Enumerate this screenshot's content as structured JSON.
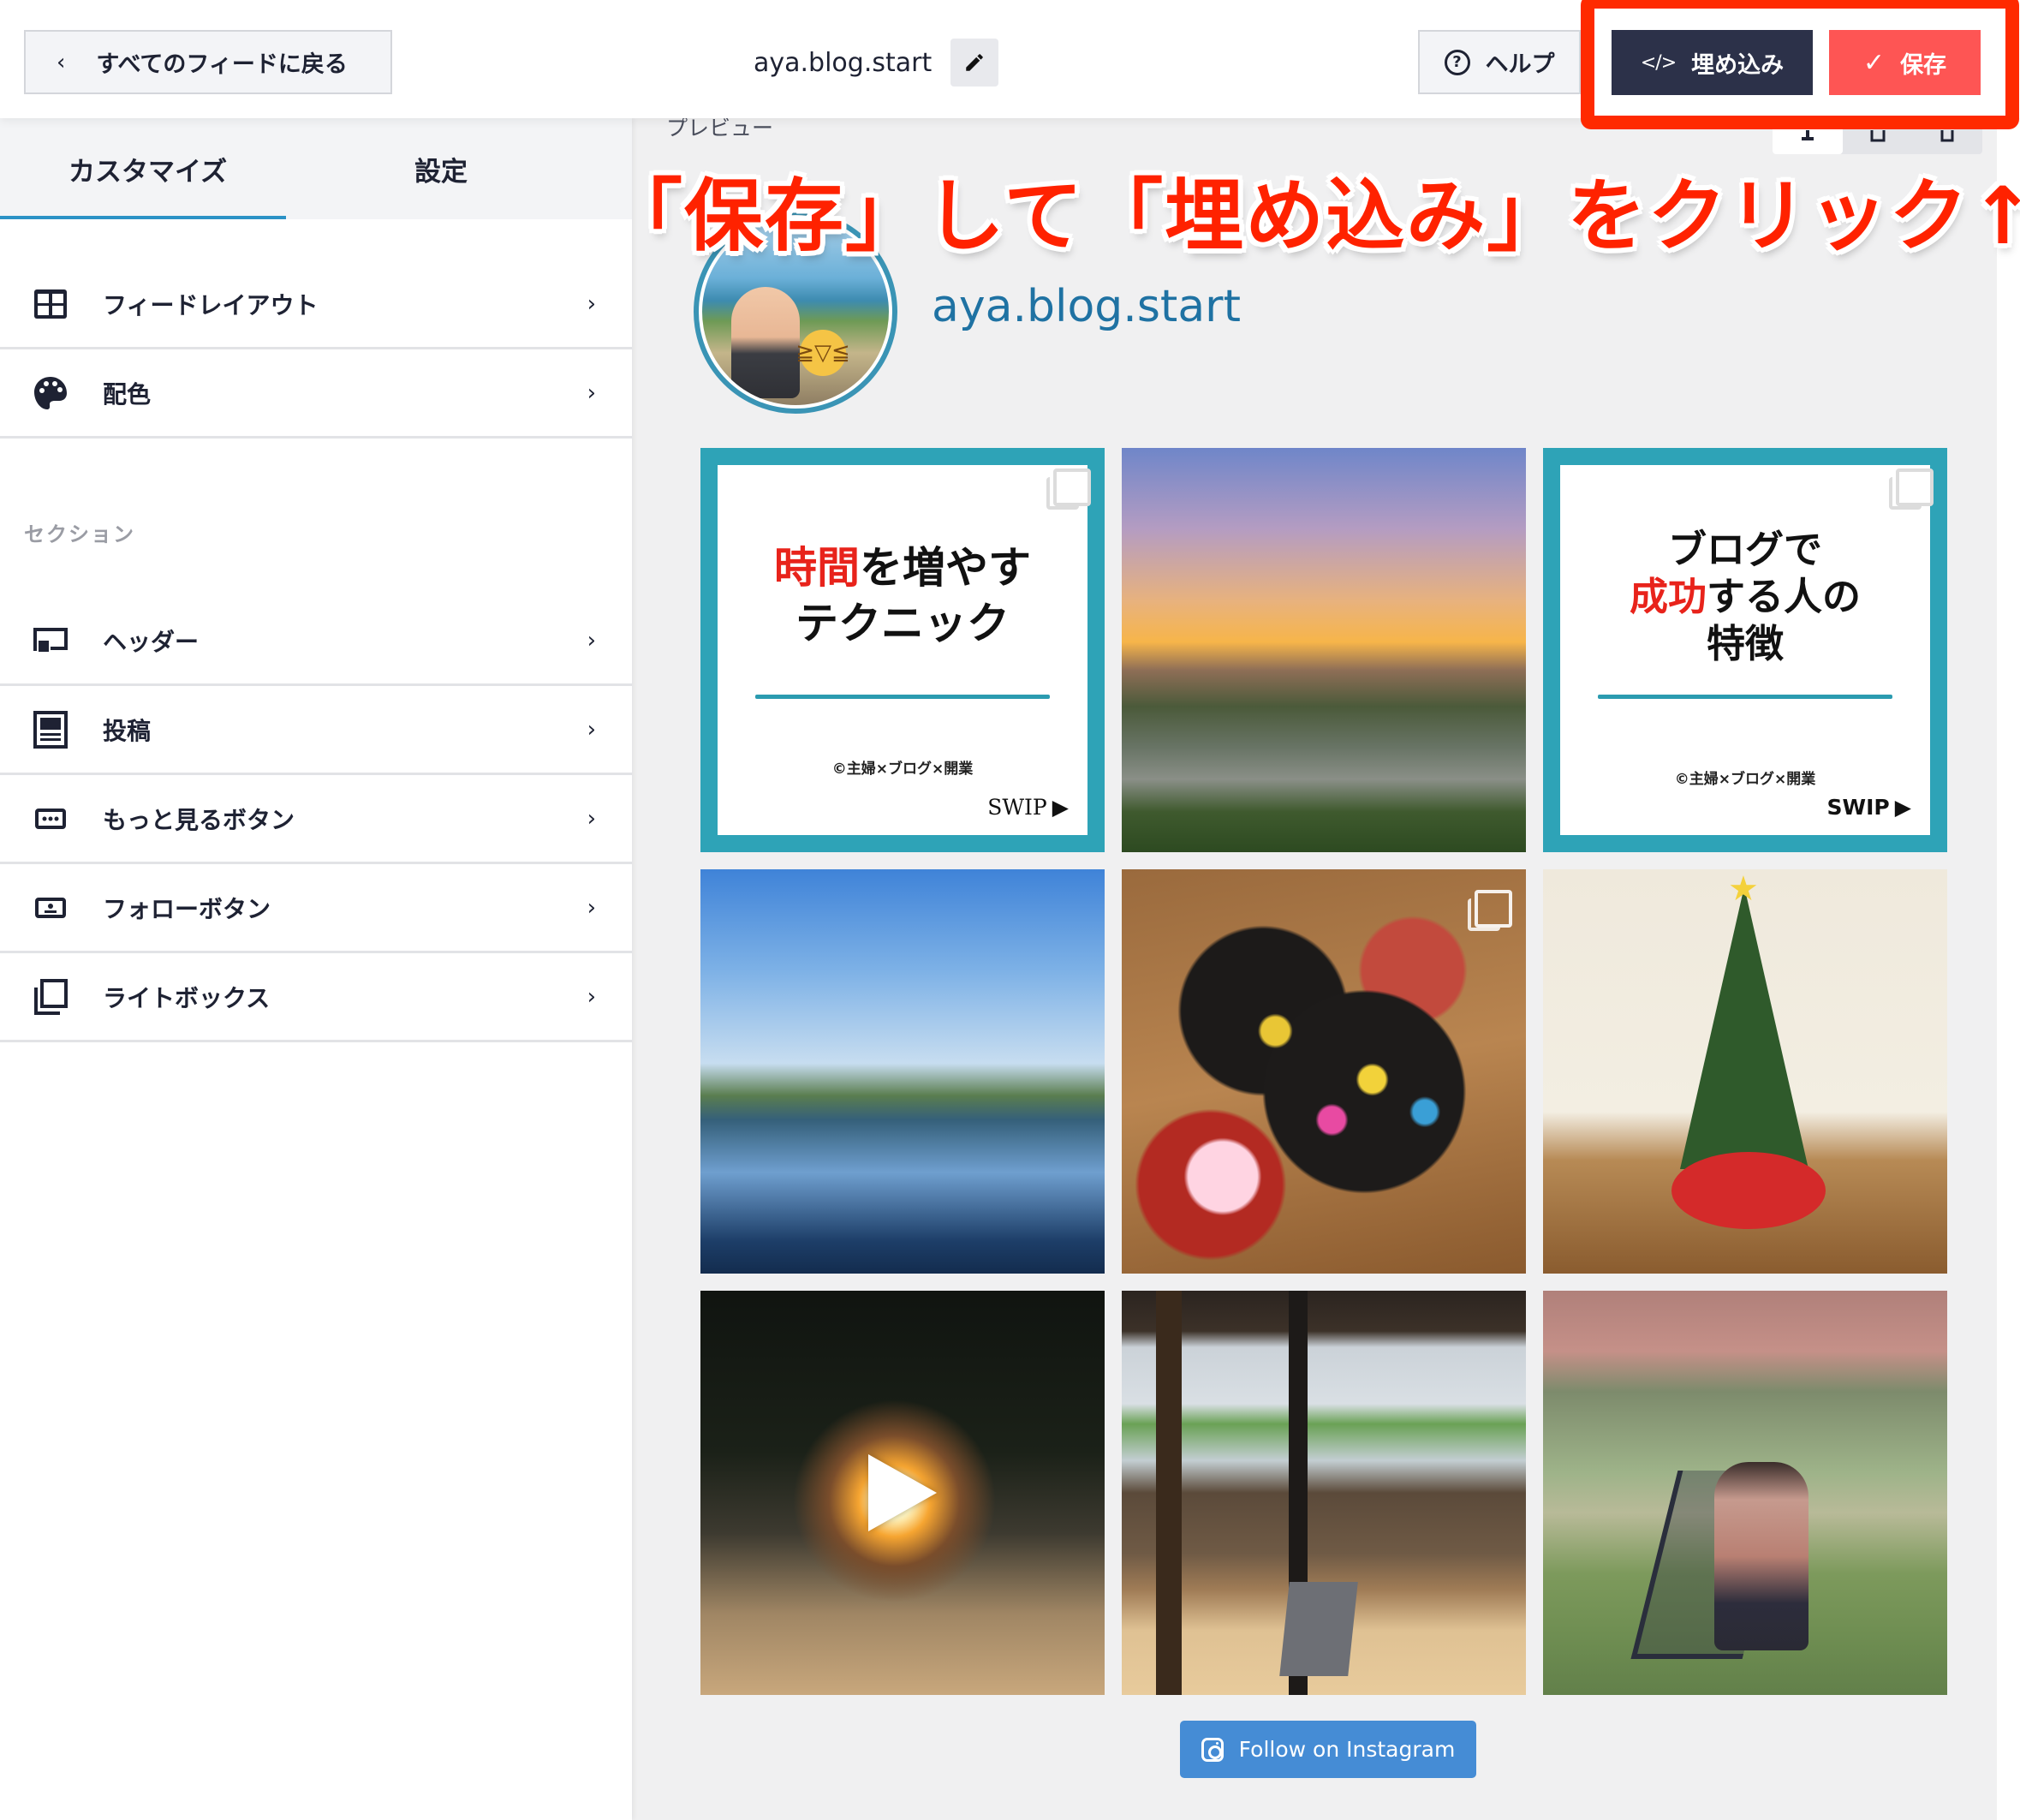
{
  "header": {
    "back_label": "すべてのフィードに戻る",
    "back_icon": "chevron-left-icon",
    "feed_name": "aya.blog.start",
    "edit_icon": "pencil-icon",
    "help_label": "ヘルプ",
    "help_icon": "question-circle-icon",
    "embed_label": "埋め込み",
    "embed_icon_glyph": "</>",
    "save_label": "保存",
    "save_icon_glyph": "✓"
  },
  "sidebar": {
    "tabs": [
      {
        "label": "カスタマイズ",
        "active": true
      },
      {
        "label": "設定",
        "active": false
      }
    ],
    "items": [
      {
        "label": "フィードレイアウト",
        "icon": "grid-layout-icon"
      },
      {
        "label": "配色",
        "icon": "palette-icon"
      }
    ],
    "section_label": "セクション",
    "section_items": [
      {
        "label": "ヘッダー",
        "icon": "header-icon"
      },
      {
        "label": "投稿",
        "icon": "post-icon"
      },
      {
        "label": "もっと見るボタン",
        "icon": "load-more-icon"
      },
      {
        "label": "フォローボタン",
        "icon": "follow-button-icon"
      },
      {
        "label": "ライトボックス",
        "icon": "lightbox-icon"
      }
    ],
    "chevron": "›"
  },
  "preview": {
    "label": "プレビュー",
    "devices": [
      "desktop",
      "tablet",
      "mobile"
    ],
    "active_device": "desktop",
    "username": "aya.blog.start",
    "posts": [
      {
        "type": "card",
        "multi": true,
        "title_red": "時間",
        "title_rest": "を増やす",
        "title_line2": "テクニック",
        "credit": "©主婦×ブログ×開業",
        "swip": "SWIP"
      },
      {
        "type": "photo",
        "multi": false,
        "subject": "sunset over lake"
      },
      {
        "type": "card",
        "multi": true,
        "title_line1": "ブログで",
        "title_red": "成功",
        "title_rest": "する人の",
        "title_line3": "特徴",
        "credit": "©主婦×ブログ×開業",
        "swip": "SWIP"
      },
      {
        "type": "photo",
        "multi": false,
        "subject": "lake and blue sky"
      },
      {
        "type": "photo",
        "multi": true,
        "subject": "osechi new year food box"
      },
      {
        "type": "photo",
        "multi": false,
        "subject": "christmas tree"
      },
      {
        "type": "video",
        "multi": false,
        "subject": "campfire at night"
      },
      {
        "type": "photo",
        "multi": false,
        "subject": "laptop on table by window"
      },
      {
        "type": "photo",
        "multi": false,
        "subject": "woman sitting in tent"
      }
    ],
    "follow_label": "Follow on Instagram"
  },
  "annotation": {
    "text": "「保存」して「埋め込み」をクリック",
    "arrow": "↑",
    "color": "#ff2200"
  },
  "colors": {
    "accent": "#2b92c6",
    "embed_bg": "#2c3149",
    "save_bg": "#fe5554",
    "follow_bg": "#458cd5",
    "highlight_border": "#ff2a00",
    "username": "#1f72a3"
  }
}
